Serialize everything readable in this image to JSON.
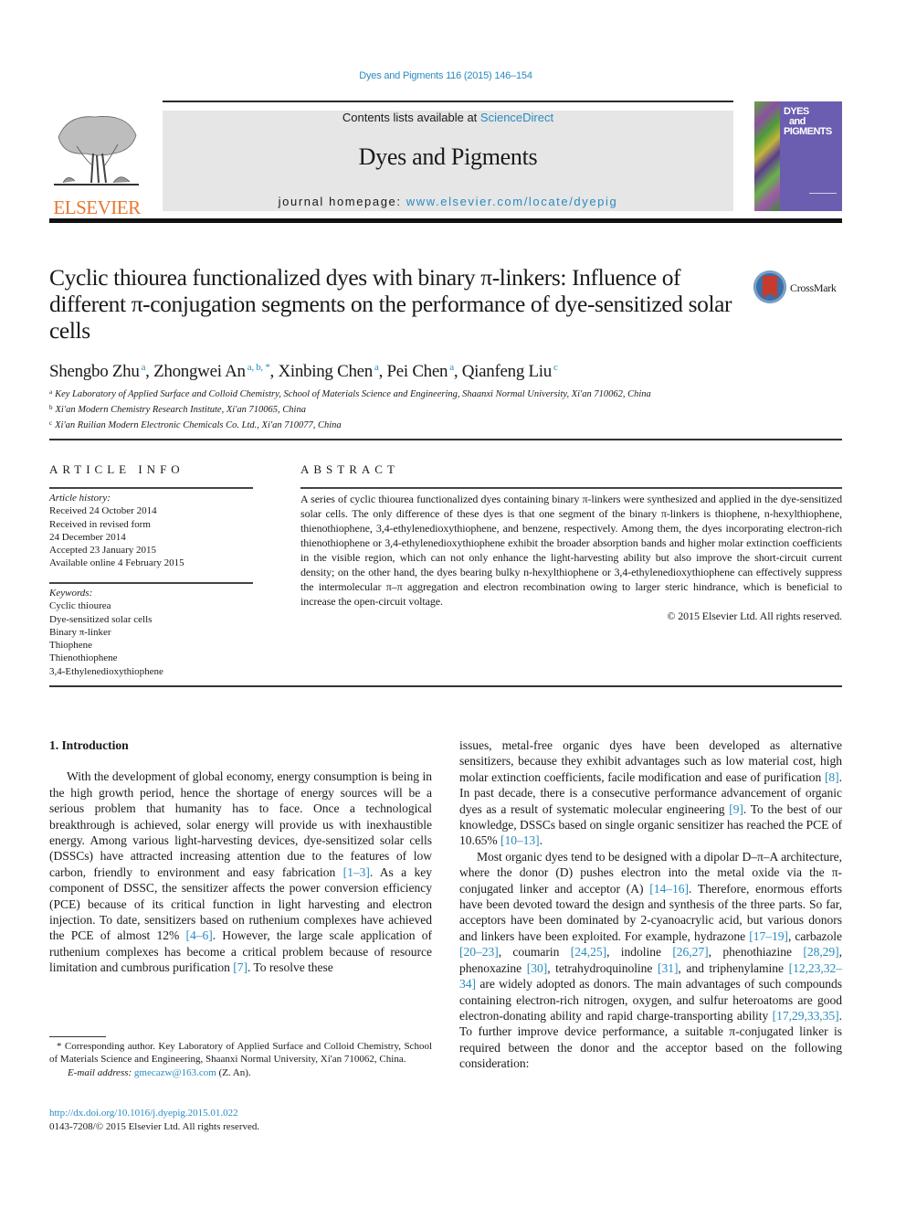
{
  "citation": "Dyes and Pigments 116 (2015) 146–154",
  "header": {
    "publisher_logo_text": "ELSEVIER",
    "contents_prefix": "Contents lists available at ",
    "contents_link": "ScienceDirect",
    "journal_title": "Dyes and Pigments",
    "homepage_prefix": "journal homepage: ",
    "homepage_link": "www.elsevier.com/locate/dyepig",
    "cover_title_lines": [
      "DYES",
      "and",
      "PIGMENTS"
    ]
  },
  "crossmark": {
    "label": "CrossMark"
  },
  "article": {
    "title": "Cyclic thiourea functionalized dyes with binary π-linkers: Influence of different π-conjugation segments on the performance of dye-sensitized solar cells",
    "authors": [
      {
        "name": "Shengbo Zhu",
        "aff": "a"
      },
      {
        "name": "Zhongwei An",
        "aff": "a, b, *"
      },
      {
        "name": "Xinbing Chen",
        "aff": "a"
      },
      {
        "name": "Pei Chen",
        "aff": "a"
      },
      {
        "name": "Qianfeng Liu",
        "aff": "c"
      }
    ],
    "affiliations": [
      {
        "key": "a",
        "text": "Key Laboratory of Applied Surface and Colloid Chemistry, School of Materials Science and Engineering, Shaanxi Normal University, Xi'an 710062, China"
      },
      {
        "key": "b",
        "text": "Xi'an Modern Chemistry Research Institute, Xi'an 710065, China"
      },
      {
        "key": "c",
        "text": "Xi'an Ruilian Modern Electronic Chemicals Co. Ltd., Xi'an 710077, China"
      }
    ]
  },
  "article_info": {
    "heading": "ARTICLE INFO",
    "history_label": "Article history:",
    "history": [
      "Received 24 October 2014",
      "Received in revised form",
      "24 December 2014",
      "Accepted 23 January 2015",
      "Available online 4 February 2015"
    ],
    "keywords_label": "Keywords:",
    "keywords": [
      "Cyclic thiourea",
      "Dye-sensitized solar cells",
      "Binary π-linker",
      "Thiophene",
      "Thienothiophene",
      "3,4-Ethylenedioxythiophene"
    ]
  },
  "abstract": {
    "heading": "ABSTRACT",
    "text": "A series of cyclic thiourea functionalized dyes containing binary π-linkers were synthesized and applied in the dye-sensitized solar cells. The only difference of these dyes is that one segment of the binary π-linkers is thiophene, n-hexylthiophene, thienothiophene, 3,4-ethylenedioxythiophene, and benzene, respectively. Among them, the dyes incorporating electron-rich thienothiophene or 3,4-ethylenedioxythiophene exhibit the broader absorption bands and higher molar extinction coefficients in the visible region, which can not only enhance the light-harvesting ability but also improve the short-circuit current density; on the other hand, the dyes bearing bulky n-hexylthiophene or 3,4-ethylenedioxythiophene can effectively suppress the intermolecular π–π aggregation and electron recombination owing to larger steric hindrance, which is beneficial to increase the open-circuit voltage.",
    "copyright": "© 2015 Elsevier Ltd. All rights reserved."
  },
  "introduction": {
    "heading": "1.  Introduction",
    "left_paragraph": [
      {
        "t": "With the development of global economy, energy consumption is being in the high growth period, hence the shortage of energy sources will be a serious problem that humanity has to face. Once a technological breakthrough is achieved, solar energy will provide us with inexhaustible energy. Among various light-harvesting devices, dye-sensitized solar cells (DSSCs) have attracted increasing attention due to the features of low carbon, friendly to environment and easy fabrication "
      },
      {
        "ref": "[1–3]"
      },
      {
        "t": ". As a key component of DSSC, the sensitizer affects the power conversion efficiency (PCE) because of its critical function in light harvesting and electron injection. To date, sensitizers based on ruthenium complexes have achieved the PCE of almost 12% "
      },
      {
        "ref": "[4–6]"
      },
      {
        "t": ". However, the large scale application of ruthenium complexes has become a critical problem because of resource limitation and cumbrous purification "
      },
      {
        "ref": "[7]"
      },
      {
        "t": ". To resolve these"
      }
    ],
    "right_paragraph_1": [
      {
        "t": "issues, metal-free organic dyes have been developed as alternative sensitizers, because they exhibit advantages such as low material cost, high molar extinction coefficients, facile modification and ease of purification "
      },
      {
        "ref": "[8]"
      },
      {
        "t": ". In past decade, there is a consecutive performance advancement of organic dyes as a result of systematic molecular engineering "
      },
      {
        "ref": "[9]"
      },
      {
        "t": ". To the best of our knowledge, DSSCs based on single organic sensitizer has reached the PCE of 10.65% "
      },
      {
        "ref": "[10–13]"
      },
      {
        "t": "."
      }
    ],
    "right_paragraph_2": [
      {
        "t": "Most organic dyes tend to be designed with a dipolar D–π–A architecture, where the donor (D) pushes electron into the metal oxide via the π-conjugated linker and acceptor (A) "
      },
      {
        "ref": "[14–16]"
      },
      {
        "t": ". Therefore, enormous efforts have been devoted toward the design and synthesis of the three parts. So far, acceptors have been dominated by 2-cyanoacrylic acid, but various donors and linkers have been exploited. For example, hydrazone "
      },
      {
        "ref": "[17–19]"
      },
      {
        "t": ", carbazole "
      },
      {
        "ref": "[20–23]"
      },
      {
        "t": ", coumarin "
      },
      {
        "ref": "[24,25]"
      },
      {
        "t": ", indoline "
      },
      {
        "ref": "[26,27]"
      },
      {
        "t": ", phenothiazine "
      },
      {
        "ref": "[28,29]"
      },
      {
        "t": ", phenoxazine "
      },
      {
        "ref": "[30]"
      },
      {
        "t": ", tetrahydroquinoline "
      },
      {
        "ref": "[31]"
      },
      {
        "t": ", and triphenylamine "
      },
      {
        "ref": "[12,23,32–34]"
      },
      {
        "t": " are widely adopted as donors. The main advantages of such compounds containing electron-rich nitrogen, oxygen, and sulfur heteroatoms are good electron-donating ability and rapid charge-transporting ability "
      },
      {
        "ref": "[17,29,33,35]"
      },
      {
        "t": ". To further improve device performance, a suitable π-conjugated linker is required between the donor and the acceptor based on the following consideration:"
      }
    ]
  },
  "footnote": {
    "star": "*",
    "text": " Corresponding author. Key Laboratory of Applied Surface and Colloid Chemistry, School of Materials Science and Engineering, Shaanxi Normal University, Xi'an 710062, China.",
    "email_label": "E-mail address: ",
    "email": "gmecazw@163.com",
    "email_suffix": " (Z. An)."
  },
  "doi": {
    "link": "http://dx.doi.org/10.1016/j.dyepig.2015.01.022",
    "issn_line": "0143-7208/© 2015 Elsevier Ltd. All rights reserved."
  },
  "colors": {
    "link": "#2a8bc0",
    "elsevier_orange": "#e8772e",
    "banner_gray": "#e6e6e6",
    "cover_purple": "#6b5db0",
    "crossmark_red": "#c73a2e"
  }
}
